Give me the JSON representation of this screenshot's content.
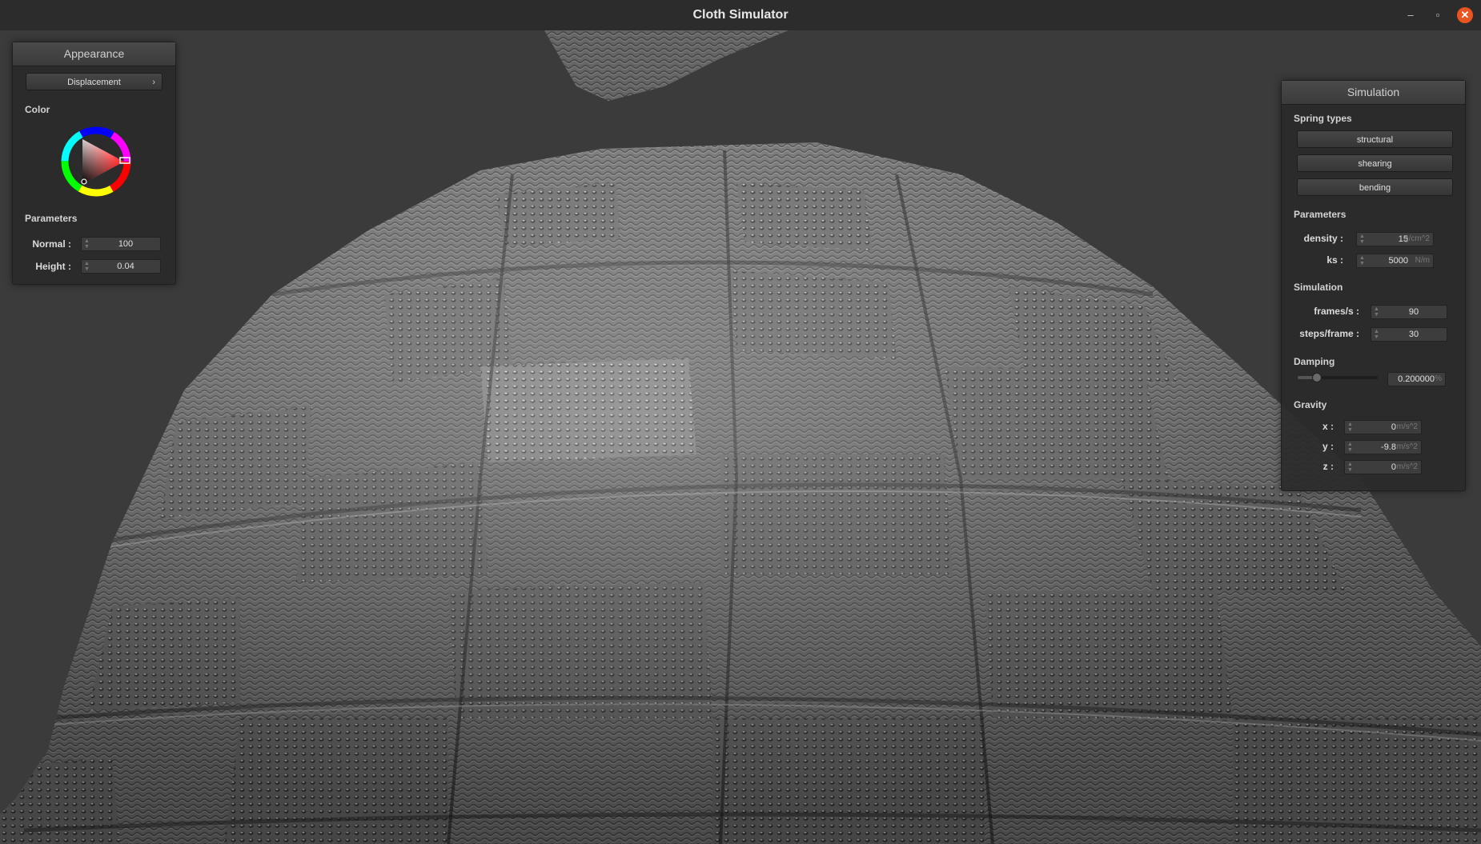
{
  "window": {
    "title": "Cloth Simulator",
    "controls": {
      "minimize": "–",
      "maximize": "▫",
      "close": "✕"
    },
    "close_color": "#e95420"
  },
  "appearance": {
    "title": "Appearance",
    "shader_dropdown": "Displacement",
    "color_section": "Color",
    "selected_hue_color": "#e03030",
    "parameters_section": "Parameters",
    "normal_label": "Normal :",
    "normal_value": "100",
    "height_label": "Height :",
    "height_value": "0.04"
  },
  "simulation": {
    "title": "Simulation",
    "spring_types_section": "Spring types",
    "spring_buttons": [
      "structural",
      "shearing",
      "bending"
    ],
    "parameters_section": "Parameters",
    "density_label": "density :",
    "density_value": "15",
    "density_unit": "g/cm^2",
    "ks_label": "ks :",
    "ks_value": "5000",
    "ks_unit": "N/m",
    "simulation_section": "Simulation",
    "fps_label": "frames/s :",
    "fps_value": "90",
    "steps_label": "steps/frame :",
    "steps_value": "30",
    "damping_section": "Damping",
    "damping_value": "0.200000",
    "damping_unit": "%",
    "damping_fraction": 0.2,
    "gravity_section": "Gravity",
    "gx_label": "x :",
    "gx_value": "0",
    "gy_label": "y :",
    "gy_value": "-9.8",
    "gz_label": "z :",
    "gz_value": "0",
    "gravity_unit": "m/s^2"
  }
}
